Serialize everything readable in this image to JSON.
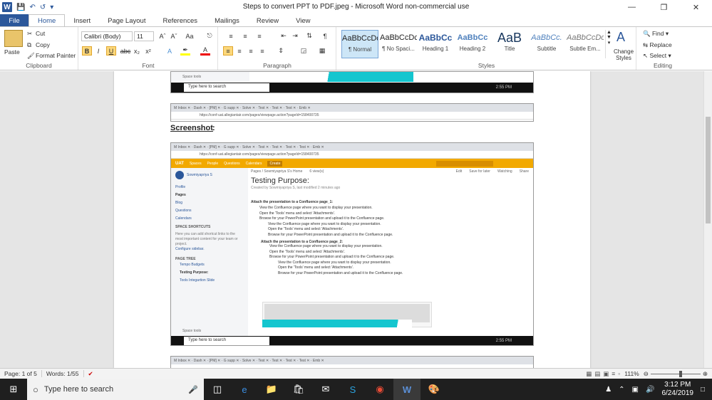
{
  "window": {
    "title": "Steps to convert PPT to PDF.jpeg  -  Microsoft Word non-commercial use"
  },
  "ribbon_tabs": [
    "File",
    "Home",
    "Insert",
    "Page Layout",
    "References",
    "Mailings",
    "Review",
    "View"
  ],
  "clipboard": {
    "paste": "Paste",
    "cut": "Cut",
    "copy": "Copy",
    "format_painter": "Format Painter",
    "label": "Clipboard"
  },
  "font": {
    "name": "Calibri (Body)",
    "size": "11",
    "label": "Font"
  },
  "paragraph": {
    "label": "Paragraph"
  },
  "styles": {
    "label": "Styles",
    "items": [
      {
        "preview": "AaBbCcDc",
        "name": "¶ Normal"
      },
      {
        "preview": "AaBbCcDc",
        "name": "¶ No Spaci..."
      },
      {
        "preview": "AaBbCc",
        "name": "Heading 1"
      },
      {
        "preview": "AaBbCc",
        "name": "Heading 2"
      },
      {
        "preview": "AaB",
        "name": "Title"
      },
      {
        "preview": "AaBbCc.",
        "name": "Subtitle"
      },
      {
        "preview": "AaBbCcDc",
        "name": "Subtle Em..."
      }
    ],
    "change_styles": "Change Styles"
  },
  "editing": {
    "find": "Find",
    "replace": "Replace",
    "select": "Select",
    "label": "Editing"
  },
  "document": {
    "heading": "Screenshot",
    "heading_suffix": ":",
    "taskbar_search": "Type here to search",
    "taskbar_time": "2:55 PM",
    "taskbar_date": "6/24/2019",
    "space_tools": "Space tools",
    "url": "https://conf-uat.allegiantair.com/pages/viewpage.action?pageId=158400735",
    "confluence": {
      "nav": [
        "UAT",
        "Spaces",
        "People",
        "Questions",
        "Calendars",
        "Create"
      ],
      "user": "Sowmiyapriya S",
      "sidebar": [
        "Profile",
        "Pages",
        "Blog",
        "Questions",
        "Calendars"
      ],
      "shortcuts_title": "SPACE SHORTCUTS",
      "shortcuts_text": "Here you can add shortcut links to the most important content for your team or project.",
      "configure": "Configure sidebar.",
      "page_tree": "PAGE TREE",
      "tree": [
        "Tempo Budgets",
        "Testing Purpose:",
        "Tools Integartion Slide"
      ],
      "breadcrumb": "Pages  /  Sowmiyapriya S's Home",
      "views": "6 view(s)",
      "actions": [
        "Edit",
        "Save for later",
        "Watching",
        "Share"
      ],
      "page_title": "Testing Purpose:",
      "byline": "Created by Sowmiyapriya S, last modified 2 minutes ago",
      "h1": "Attach the presentation to a Confluence page_1:",
      "list1": [
        "View the Confluence page where you want to display your presentation.",
        "Open the 'Tools' menu and select 'Attachments'.",
        "Browse for your PowerPoint presentation and upload it to the Confluence page."
      ],
      "list1b": [
        "View the Confluence page where you want to display your presentation.",
        "Open the 'Tools' menu and select 'Attachments'.",
        "Browse for your PowerPoint presentation and upload it to the Confluence page."
      ],
      "h2": "Attach the presentation to a Confluence page_2:",
      "list2": [
        "View the Confluence page where you want to display your presentation.",
        "Open the 'Tools' menu and select 'Attachments'.",
        "Browse for your PowerPoint presentation and upload it to the Confluence page."
      ],
      "list2b": [
        "View the Confluence page where you want to display your presentation.",
        "Open the 'Tools' menu and select 'Attachments'.",
        "Browse for your PowerPoint presentation and upload it to the Confluence page."
      ]
    }
  },
  "status": {
    "page": "Page: 1 of 5",
    "words": "Words: 1/55",
    "zoom": "111%"
  },
  "taskbar": {
    "search": "Type here to search",
    "time": "3:12 PM",
    "date": "6/24/2019"
  }
}
